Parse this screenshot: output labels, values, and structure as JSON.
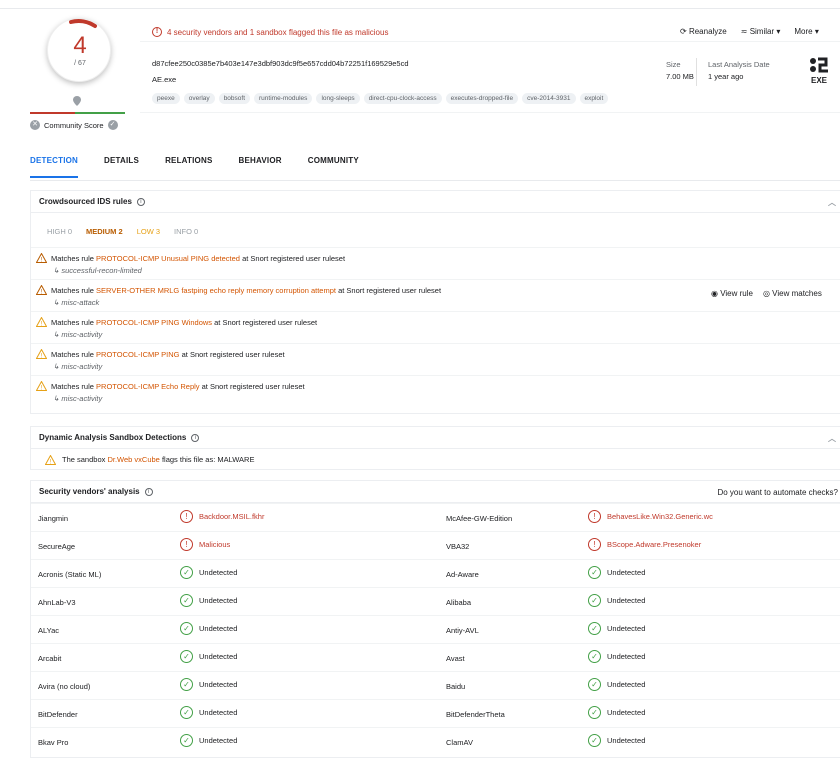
{
  "header": {
    "score": "4",
    "score_total": "/ 67",
    "community_label": "Community Score",
    "alert": "4 security vendors and 1 sandbox flagged this file as malicious",
    "actions": [
      "Reanalyze",
      "Similar ▾",
      "More ▾"
    ],
    "hash": "d87cfee250c0385e7b403e147e3dbf903dc9f5e657cdd04b72251f169529e5cd",
    "file_name": "AE.exe",
    "tags": [
      "peexe",
      "overlay",
      "bobsoft",
      "runtime-modules",
      "long-sleeps",
      "direct-cpu-clock-access",
      "executes-dropped-file",
      "cve-2014-3931",
      "exploit"
    ],
    "size_label": "Size",
    "size_value": "7.00 MB",
    "date_label": "Last Analysis Date",
    "date_value": "1 year ago",
    "file_type": "EXE"
  },
  "tabs": [
    "DETECTION",
    "DETAILS",
    "RELATIONS",
    "BEHAVIOR",
    "COMMUNITY"
  ],
  "ids": {
    "title": "Crowdsourced IDS rules",
    "severity": [
      {
        "label": "HIGH 0",
        "color": "#9aa0a6"
      },
      {
        "label": "MEDIUM 2",
        "color": "#b85c00"
      },
      {
        "label": "LOW 3",
        "color": "#e6a117"
      },
      {
        "label": "INFO 0",
        "color": "#9aa0a6"
      }
    ],
    "rules": [
      {
        "prefix": "Matches rule",
        "name": "PROTOCOL-ICMP Unusual PING detected",
        "suffix": "at Snort registered user ruleset",
        "class": "successful-recon-limited"
      },
      {
        "prefix": "Matches rule",
        "name": "SERVER-OTHER MRLG fastping echo reply memory corruption attempt",
        "suffix": "at Snort registered user ruleset",
        "class": "misc-attack"
      },
      {
        "prefix": "Matches rule",
        "name": "PROTOCOL-ICMP PING Windows",
        "suffix": "at Snort registered user ruleset",
        "class": "misc-activity"
      },
      {
        "prefix": "Matches rule",
        "name": "PROTOCOL-ICMP PING",
        "suffix": "at Snort registered user ruleset",
        "class": "misc-activity"
      },
      {
        "prefix": "Matches rule",
        "name": "PROTOCOL-ICMP Echo Reply",
        "suffix": "at Snort registered user ruleset",
        "class": "misc-activity"
      }
    ],
    "view_rule": "View rule",
    "view_matches": "View matches"
  },
  "dynamic": {
    "title": "Dynamic Analysis Sandbox Detections",
    "prefix": "The sandbox",
    "sandbox": "Dr.Web vxCube",
    "suffix": "flags this file as: MALWARE"
  },
  "vendors": {
    "title": "Security vendors' analysis",
    "automate": "Do you want to automate checks?",
    "rows": [
      {
        "left_name": "Jiangmin",
        "left_result": "Backdoor.MSIL.fkhr",
        "left_bad": true,
        "right_name": "McAfee-GW-Edition",
        "right_result": "BehavesLike.Win32.Generic.wc",
        "right_bad": true
      },
      {
        "left_name": "SecureAge",
        "left_result": "Malicious",
        "left_bad": true,
        "right_name": "VBA32",
        "right_result": "BScope.Adware.Presenoker",
        "right_bad": true
      },
      {
        "left_name": "Acronis (Static ML)",
        "left_result": "Undetected",
        "left_bad": false,
        "right_name": "Ad-Aware",
        "right_result": "Undetected",
        "right_bad": false
      },
      {
        "left_name": "AhnLab-V3",
        "left_result": "Undetected",
        "left_bad": false,
        "right_name": "Alibaba",
        "right_result": "Undetected",
        "right_bad": false
      },
      {
        "left_name": "ALYac",
        "left_result": "Undetected",
        "left_bad": false,
        "right_name": "Antiy-AVL",
        "right_result": "Undetected",
        "right_bad": false
      },
      {
        "left_name": "Arcabit",
        "left_result": "Undetected",
        "left_bad": false,
        "right_name": "Avast",
        "right_result": "Undetected",
        "right_bad": false
      },
      {
        "left_name": "Avira (no cloud)",
        "left_result": "Undetected",
        "left_bad": false,
        "right_name": "Baidu",
        "right_result": "Undetected",
        "right_bad": false
      },
      {
        "left_name": "BitDefender",
        "left_result": "Undetected",
        "left_bad": false,
        "right_name": "BitDefenderTheta",
        "right_result": "Undetected",
        "right_bad": false
      },
      {
        "left_name": "Bkav Pro",
        "left_result": "Undetected",
        "left_bad": false,
        "right_name": "ClamAV",
        "right_result": "Undetected",
        "right_bad": false
      }
    ]
  },
  "colors": {
    "malicious": "#c0392b",
    "clean": "#43a047",
    "accent": "#1a73e8",
    "rule": "#d35400"
  }
}
